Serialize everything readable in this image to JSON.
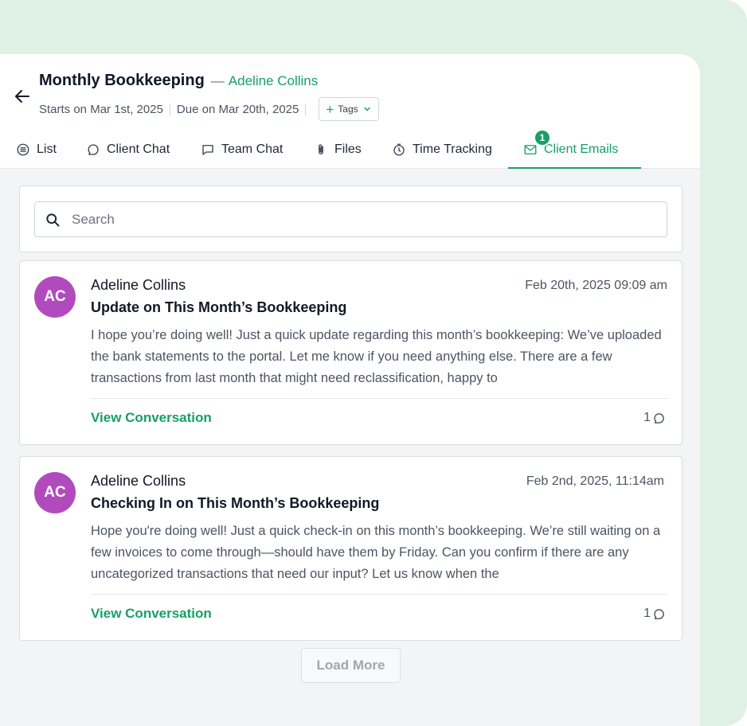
{
  "header": {
    "title": "Monthly Bookkeeping",
    "dash": "—",
    "client_name": "Adeline Collins",
    "starts": "Starts on Mar 1st, 2025",
    "due": "Due on Mar 20th, 2025",
    "tags_label": "Tags"
  },
  "tabs": [
    {
      "label": "List",
      "icon": "list-icon"
    },
    {
      "label": "Client Chat",
      "icon": "chat-bubble-icon"
    },
    {
      "label": "Team Chat",
      "icon": "message-square-icon"
    },
    {
      "label": "Files",
      "icon": "paperclip-icon"
    },
    {
      "label": "Time Tracking",
      "icon": "timer-icon"
    },
    {
      "label": "Client Emails",
      "icon": "envelope-icon",
      "badge": "1",
      "active": true
    }
  ],
  "search": {
    "placeholder": "Search"
  },
  "emails": [
    {
      "initials": "AC",
      "sender": "Adeline Collins",
      "subject": "Update on This Month’s Bookkeeping",
      "date": "Feb 20th, 2025 09:09 am",
      "preview": "I hope you’re doing well! Just a quick update regarding this month’s bookkeeping: We’ve uploaded the bank statements to the portal. Let me know if you need anything else. There are a few transactions from last month that might need reclassification, happy to",
      "action": "View Conversation",
      "reply_count": "1"
    },
    {
      "initials": "AC",
      "sender": "Adeline Collins",
      "subject": "Checking In on This Month’s Bookkeeping",
      "date": "Feb 2nd, 2025, 11:14am",
      "preview": "Hope you're doing well! Just a quick check-in on this month’s bookkeeping. We’re still waiting on a few invoices to come through—should have them by Friday. Can you confirm if there are any uncategorized transactions that need our input? Let us know when the",
      "action": "View Conversation",
      "reply_count": "1"
    }
  ],
  "load_more": "Load More",
  "colors": {
    "accent": "#16a066",
    "avatar": "#b14bbd",
    "frame": "#dff0e5"
  }
}
